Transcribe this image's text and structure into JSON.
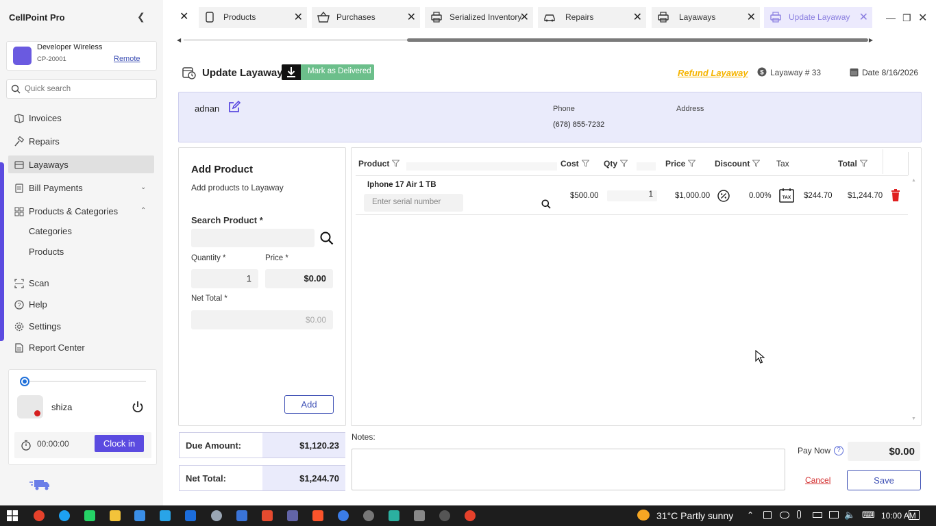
{
  "app": {
    "title": "CellPoint Pro"
  },
  "store": {
    "name": "Developer Wireless",
    "id": "CP-20001",
    "remote_label": "Remote"
  },
  "search": {
    "placeholder": "Quick search"
  },
  "sidebar": {
    "items": [
      {
        "label": "Invoices",
        "icon": "invoice-icon"
      },
      {
        "label": "Repairs",
        "icon": "hammer-icon"
      },
      {
        "label": "Layaways",
        "icon": "layaway-icon",
        "active": true
      },
      {
        "label": "Bill Payments",
        "icon": "bill-icon",
        "chevron": "down"
      },
      {
        "label": "Products & Categories",
        "icon": "grid-icon",
        "chevron": "up"
      },
      {
        "label": "Categories",
        "sub": true
      },
      {
        "label": "Products",
        "sub": true
      },
      {
        "label": "Scan",
        "icon": "scan-icon"
      },
      {
        "label": "Help",
        "icon": "help-icon"
      },
      {
        "label": "Settings",
        "icon": "gear-icon"
      },
      {
        "label": "Report Center",
        "icon": "report-icon"
      }
    ]
  },
  "user": {
    "name": "shiza",
    "timer": "00:00:00",
    "clock_in_label": "Clock in"
  },
  "tabs": [
    {
      "label": "Products",
      "icon": "printer-icon"
    },
    {
      "label": "Purchases",
      "icon": "basket-icon"
    },
    {
      "label": "Serialized Inventory",
      "icon": "printer-icon"
    },
    {
      "label": "Repairs",
      "icon": "car-icon"
    },
    {
      "label": "Layaways",
      "icon": "printer-icon"
    },
    {
      "label": "Update Layaway",
      "icon": "printer-icon",
      "active": true
    }
  ],
  "header": {
    "title": "Update Layaway",
    "mark_delivered_label": "Mark as Delivered",
    "refund_label": "Refund Layaway",
    "layaway_number": "Layaway # 33",
    "date": "Date 8/16/2026"
  },
  "customer": {
    "name": "adnan",
    "phone_label": "Phone",
    "phone": "(678) 855-7232",
    "address_label": "Address",
    "address": ""
  },
  "add_product": {
    "title": "Add Product",
    "subtitle": "Add products to Layaway",
    "search_label": "Search Product *",
    "quantity_label": "Quantity *",
    "quantity": "1",
    "price_label": "Price *",
    "price": "$0.00",
    "net_total_label": "Net Total *",
    "net_total": "$0.00",
    "add_label": "Add"
  },
  "grid": {
    "columns": [
      "Product",
      "Cost",
      "Qty",
      "Price",
      "Discount",
      "Tax",
      "Total"
    ],
    "rows": [
      {
        "product": "Iphone 17 Air 1 TB",
        "serial_placeholder": "Enter serial number",
        "cost": "$500.00",
        "qty": "1",
        "price": "$1,000.00",
        "discount": "0.00%",
        "tax": "$244.70",
        "total": "$1,244.70"
      }
    ]
  },
  "summary": {
    "due_label": "Due Amount:",
    "due": "$1,120.23",
    "net_label": "Net Total:",
    "net": "$1,244.70"
  },
  "notes": {
    "label": "Notes:"
  },
  "payment": {
    "pay_now_label": "Pay Now",
    "pay_now": "$0.00",
    "cancel_label": "Cancel",
    "save_label": "Save"
  },
  "taskbar": {
    "weather": "31°C  Partly sunny",
    "time": "10:00 AM"
  },
  "colors": {
    "accent": "#5b4be0",
    "mark_delivered": "#6cbf8b",
    "refund": "#f5b400",
    "customer_bg": "#eaebfb",
    "delete": "#e02020"
  }
}
